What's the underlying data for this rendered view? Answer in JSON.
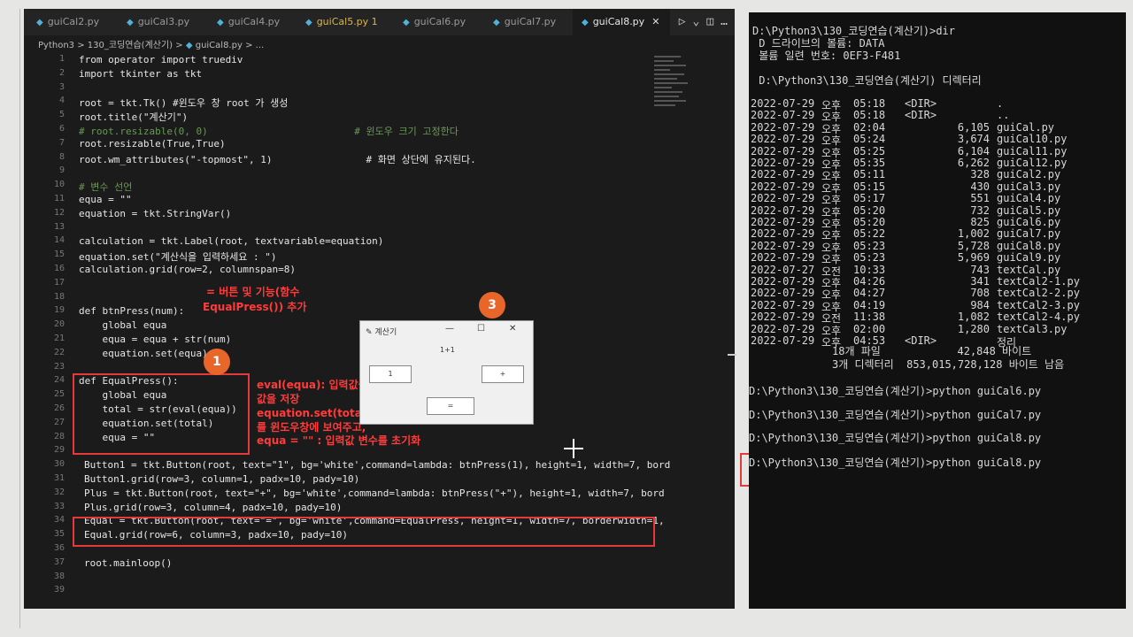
{
  "tabs": [
    {
      "label": "guiCal2.py",
      "state": "normal"
    },
    {
      "label": "guiCal3.py",
      "state": "normal"
    },
    {
      "label": "guiCal4.py",
      "state": "normal"
    },
    {
      "label": "guiCal5.py 1",
      "state": "modified"
    },
    {
      "label": "guiCal6.py",
      "state": "normal"
    },
    {
      "label": "guiCal7.py",
      "state": "normal"
    },
    {
      "label": "guiCal8.py",
      "state": "active"
    }
  ],
  "breadcrumb": {
    "part1": "Python3",
    "part2": "130_코딩연습(계산기)",
    "part3": "guiCal8.py",
    "part4": "..."
  },
  "code_lines": [
    {
      "n": "1",
      "text": "from operator import truediv"
    },
    {
      "n": "2",
      "text": "import tkinter as tkt"
    },
    {
      "n": "3",
      "text": ""
    },
    {
      "n": "4",
      "text": "root = tkt.Tk() #윈도우 창 root 가 생성"
    },
    {
      "n": "5",
      "text": "root.title(\"계산기\")"
    },
    {
      "n": "6",
      "text": "# root.resizable(0, 0)                         # 윈도우 크기 고정한다"
    },
    {
      "n": "7",
      "text": "root.resizable(True,True)"
    },
    {
      "n": "8",
      "text": "root.wm_attributes(\"-topmost\", 1)                # 화면 상단에 유지된다."
    },
    {
      "n": "9",
      "text": ""
    },
    {
      "n": "10",
      "text": "# 변수 선언"
    },
    {
      "n": "11",
      "text": "equa = \"\""
    },
    {
      "n": "12",
      "text": "equation = tkt.StringVar()"
    },
    {
      "n": "13",
      "text": ""
    },
    {
      "n": "14",
      "text": "calculation = tkt.Label(root, textvariable=equation)"
    },
    {
      "n": "15",
      "text": "equation.set(\"계산식을 입력하세요 : \")"
    },
    {
      "n": "16",
      "text": "calculation.grid(row=2, columnspan=8)"
    },
    {
      "n": "17",
      "text": ""
    },
    {
      "n": "18",
      "text": ""
    },
    {
      "n": "19",
      "text": "def btnPress(num):"
    },
    {
      "n": "20",
      "text": "    global equa"
    },
    {
      "n": "21",
      "text": "    equa = equa + str(num)"
    },
    {
      "n": "22",
      "text": "    equation.set(equa)"
    },
    {
      "n": "23",
      "text": ""
    },
    {
      "n": "24",
      "text": "def EqualPress():"
    },
    {
      "n": "25",
      "text": "    global equa"
    },
    {
      "n": "26",
      "text": "    total = str(eval(equa))"
    },
    {
      "n": "27",
      "text": "    equation.set(total)"
    },
    {
      "n": "28",
      "text": "    equa = \"\""
    },
    {
      "n": "29",
      "text": ""
    },
    {
      "n": "30",
      "text": "Button1 = tkt.Button(root, text=\"1\", bg='white',command=lambda: btnPress(1), height=1, width=7, bord"
    },
    {
      "n": "31",
      "text": "Button1.grid(row=3, column=1, padx=10, pady=10)"
    },
    {
      "n": "32",
      "text": "Plus = tkt.Button(root, text=\"+\", bg='white',command=lambda: btnPress(\"+\"), height=1, width=7, bord"
    },
    {
      "n": "33",
      "text": "Plus.grid(row=3, column=4, padx=10, pady=10)"
    },
    {
      "n": "34",
      "text": "Equal = tkt.Button(root, text=\"=\", bg='white',command=EqualPress, height=1, width=7, borderwidth=1,"
    },
    {
      "n": "35",
      "text": "Equal.grid(row=6, column=3, padx=10, pady=10)"
    },
    {
      "n": "36",
      "text": ""
    },
    {
      "n": "37",
      "text": "root.mainloop()"
    },
    {
      "n": "38",
      "text": ""
    },
    {
      "n": "39",
      "text": ""
    }
  ],
  "annotations": {
    "a17_line1": "= 버튼 및 기능(함수",
    "a17_line2": "EqualPress()) 추가",
    "eval_1": "eval(equa): 입력값을 계산한 결과",
    "eval_2": "값을 저장",
    "eval_3": "equation.set(total) : 계산결과",
    "eval_4": "를 윈도우창에 보여주고,",
    "eval_5": "equa = \"\" : 입력값 변수를 초기화",
    "badge1": "1",
    "badge2": "2",
    "badge3": "3"
  },
  "tk_window": {
    "title": "계산기",
    "minimize": "—",
    "maximize": "☐",
    "close": "✕",
    "label": "1+1",
    "btn1": "1",
    "btn_plus": "+",
    "btn_equal": "="
  },
  "terminal": {
    "lines_top": [
      "D:\\Python3\\130_코딩연습(계산기)>dir",
      " D 드라이브의 볼륨: DATA",
      " 볼륨 일련 번호: 0EF3-F481",
      "",
      " D:\\Python3\\130_코딩연습(계산기) 디렉터리"
    ],
    "dir_entries": [
      {
        "date": "2022-07-29",
        "ampm": "오후",
        "time": "05:18",
        "size": "<DIR>",
        "name": "."
      },
      {
        "date": "2022-07-29",
        "ampm": "오후",
        "time": "05:18",
        "size": "<DIR>",
        "name": ".."
      },
      {
        "date": "2022-07-29",
        "ampm": "오후",
        "time": "02:04",
        "size": "6,105",
        "name": "guiCal.py"
      },
      {
        "date": "2022-07-29",
        "ampm": "오후",
        "time": "05:24",
        "size": "3,674",
        "name": "guiCal10.py"
      },
      {
        "date": "2022-07-29",
        "ampm": "오후",
        "time": "05:25",
        "size": "6,104",
        "name": "guiCal11.py"
      },
      {
        "date": "2022-07-29",
        "ampm": "오후",
        "time": "05:35",
        "size": "6,262",
        "name": "guiCal12.py"
      },
      {
        "date": "2022-07-29",
        "ampm": "오후",
        "time": "05:11",
        "size": "328",
        "name": "guiCal2.py"
      },
      {
        "date": "2022-07-29",
        "ampm": "오후",
        "time": "05:15",
        "size": "430",
        "name": "guiCal3.py"
      },
      {
        "date": "2022-07-29",
        "ampm": "오후",
        "time": "05:17",
        "size": "551",
        "name": "guiCal4.py"
      },
      {
        "date": "2022-07-29",
        "ampm": "오후",
        "time": "05:20",
        "size": "732",
        "name": "guiCal5.py"
      },
      {
        "date": "2022-07-29",
        "ampm": "오후",
        "time": "05:20",
        "size": "825",
        "name": "guiCal6.py"
      },
      {
        "date": "2022-07-29",
        "ampm": "오후",
        "time": "05:22",
        "size": "1,002",
        "name": "guiCal7.py"
      },
      {
        "date": "2022-07-29",
        "ampm": "오후",
        "time": "05:23",
        "size": "5,728",
        "name": "guiCal8.py"
      },
      {
        "date": "2022-07-29",
        "ampm": "오후",
        "time": "05:23",
        "size": "5,969",
        "name": "guiCal9.py"
      },
      {
        "date": "2022-07-27",
        "ampm": "오전",
        "time": "10:33",
        "size": "743",
        "name": "textCal.py"
      },
      {
        "date": "2022-07-29",
        "ampm": "오후",
        "time": "04:26",
        "size": "341",
        "name": "textCal2-1.py"
      },
      {
        "date": "2022-07-29",
        "ampm": "오후",
        "time": "04:27",
        "size": "708",
        "name": "textCal2-2.py"
      },
      {
        "date": "2022-07-29",
        "ampm": "오후",
        "time": "04:19",
        "size": "984",
        "name": "textCal2-3.py"
      },
      {
        "date": "2022-07-29",
        "ampm": "오전",
        "time": "11:38",
        "size": "1,082",
        "name": "textCal2-4.py"
      },
      {
        "date": "2022-07-29",
        "ampm": "오후",
        "time": "02:00",
        "size": "1,280",
        "name": "textCal3.py"
      },
      {
        "date": "2022-07-29",
        "ampm": "오후",
        "time": "04:53",
        "size": "<DIR>",
        "name": "정리"
      }
    ],
    "summary_files": "18개 파일            42,848 바이트",
    "summary_dirs": "3개 디렉터리  853,015,728,128 바이트 남음",
    "cmd1": "D:\\Python3\\130_코딩연습(계산기)>python guiCal6.py",
    "cmd2": "D:\\Python3\\130_코딩연습(계산기)>python guiCal7.py",
    "cmd3": "D:\\Python3\\130_코딩연습(계산기)>python guiCal8.py",
    "cmd4": "D:\\Python3\\130_코딩연습(계산기)>python guiCal8.py"
  }
}
